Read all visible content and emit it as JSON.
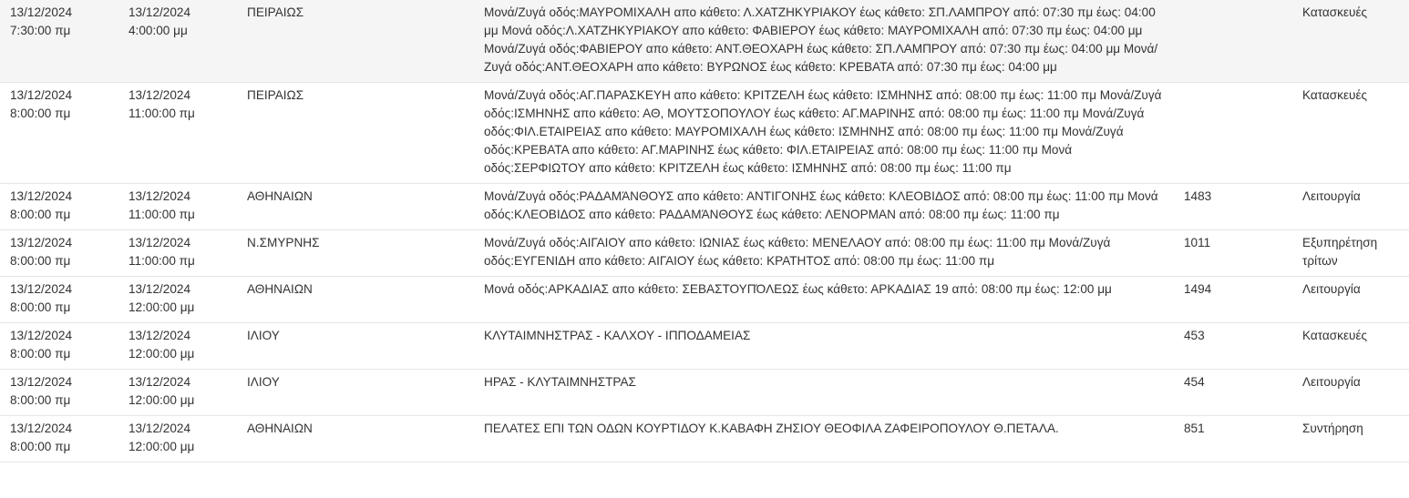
{
  "rows": [
    {
      "start_date": "13/12/2024",
      "start_time": "7:30:00 πμ",
      "end_date": "13/12/2024",
      "end_time": "4:00:00 μμ",
      "area": "ΠΕΙΡΑΙΩΣ",
      "description": "Μονά/Ζυγά οδός:ΜΑΥΡΟΜΙΧΑΛΗ απο κάθετο: Λ.ΧΑΤΖΗΚΥΡΙΑΚΟΥ έως κάθετο: ΣΠ.ΛΑΜΠΡΟΥ από: 07:30 πμ έως: 04:00 μμ Μονά οδός:Λ.ΧΑΤΖΗΚΥΡΙΑΚΟΥ απο κάθετο: ΦΑΒΙΕΡΟΥ έως κάθετο: ΜΑΥΡΟΜΙΧΑΛΗ από: 07:30 πμ έως: 04:00 μμ Μονά/Ζυγά οδός:ΦΑΒΙΕΡΟΥ απο κάθετο: ΑΝΤ.ΘΕΟΧΑΡΗ έως κάθετο: ΣΠ.ΛΑΜΠΡΟΥ από: 07:30 πμ έως: 04:00 μμ Μονά/Ζυγά οδός:ΑΝΤ.ΘΕΟΧΑΡΗ απο κάθετο: ΒΥΡΩΝΟΣ έως κάθετο: ΚΡΕΒΑΤΑ από: 07:30 πμ έως: 04:00 μμ",
      "number": "",
      "reason": "Κατασκευές"
    },
    {
      "start_date": "13/12/2024",
      "start_time": "8:00:00 πμ",
      "end_date": "13/12/2024",
      "end_time": "11:00:00 πμ",
      "area": "ΠΕΙΡΑΙΩΣ",
      "description": "Μονά/Ζυγά οδός:ΑΓ.ΠΑΡΑΣΚΕΥΗ απο κάθετο: ΚΡΙΤΖΕΛΗ έως κάθετο: ΙΣΜΗΝΗΣ από: 08:00 πμ έως: 11:00 πμ Μονά/Ζυγά οδός:ΙΣΜΗΝΗΣ απο κάθετο: ΑΘ, ΜΟΥΤΣΟΠΟΥΛΟΥ έως κάθετο: ΑΓ.ΜΑΡΙΝΗΣ από: 08:00 πμ έως: 11:00 πμ Μονά/Ζυγά οδός:ΦΙΛ.ΕΤΑΙΡΕΙΑΣ απο κάθετο: ΜΑΥΡΟΜΙΧΑΛΗ έως κάθετο: ΙΣΜΗΝΗΣ από: 08:00 πμ έως: 11:00 πμ Μονά/Ζυγά οδός:ΚΡΕΒΑΤΑ απο κάθετο: ΑΓ.ΜΑΡΙΝΗΣ έως κάθετο: ΦΙΛ.ΕΤΑΙΡΕΙΑΣ από: 08:00 πμ έως: 11:00 πμ Μονά οδός:ΣΕΡΦΙΩΤΟΥ απο κάθετο: ΚΡΙΤΖΕΛΗ έως κάθετο: ΙΣΜΗΝΗΣ από: 08:00 πμ έως: 11:00 πμ",
      "number": "",
      "reason": "Κατασκευές"
    },
    {
      "start_date": "13/12/2024",
      "start_time": "8:00:00 πμ",
      "end_date": "13/12/2024",
      "end_time": "11:00:00 πμ",
      "area": "ΑΘΗΝΑΙΩΝ",
      "description": "Μονά/Ζυγά οδός:ΡΑΔΑΜΆΝΘΟΥΣ απο κάθετο: ΑΝΤΙΓΟΝΗΣ έως κάθετο: ΚΛΕΟΒΙΔΟΣ από: 08:00 πμ έως: 11:00 πμ Μονά οδός:ΚΛΕΟΒΙΔΟΣ απο κάθετο: ΡΑΔΑΜΆΝΘΟΥΣ έως κάθετο: ΛΕΝΟΡΜΑΝ από: 08:00 πμ έως: 11:00 πμ",
      "number": "1483",
      "reason": "Λειτουργία"
    },
    {
      "start_date": "13/12/2024",
      "start_time": "8:00:00 πμ",
      "end_date": "13/12/2024",
      "end_time": "11:00:00 πμ",
      "area": "Ν.ΣΜΥΡΝΗΣ",
      "description": "Μονά/Ζυγά οδός:ΑΙΓΑΙΟΥ απο κάθετο: ΙΩΝΙΑΣ έως κάθετο: ΜΕΝΕΛΑΟΥ από: 08:00 πμ έως: 11:00 πμ Μονά/Ζυγά οδός:ΕΥΓΕΝΙΔΗ απο κάθετο: ΑΙΓΑΙΟΥ έως κάθετο: ΚΡΑΤΗΤΟΣ από: 08:00 πμ έως: 11:00 πμ",
      "number": "1011",
      "reason": "Εξυπηρέτηση τρίτων"
    },
    {
      "start_date": "13/12/2024",
      "start_time": "8:00:00 πμ",
      "end_date": "13/12/2024",
      "end_time": "12:00:00 μμ",
      "area": "ΑΘΗΝΑΙΩΝ",
      "description": "Μονά οδός:ΑΡΚΑΔΙΑΣ απο κάθετο: ΣΕΒΑΣΤΟΥΠΌΛΕΩΣ έως κάθετο: ΑΡΚΑΔΙΑΣ 19 από: 08:00 πμ έως: 12:00 μμ",
      "number": "1494",
      "reason": "Λειτουργία"
    },
    {
      "start_date": "13/12/2024",
      "start_time": "8:00:00 πμ",
      "end_date": "13/12/2024",
      "end_time": "12:00:00 μμ",
      "area": "ΙΛΙΟΥ",
      "description": "ΚΛΥΤΑΙΜΝΗΣΤΡΑΣ - ΚΑΛΧΟΥ - ΙΠΠΟΔΑΜΕΙΑΣ",
      "number": "453",
      "reason": "Κατασκευές"
    },
    {
      "start_date": "13/12/2024",
      "start_time": "8:00:00 πμ",
      "end_date": "13/12/2024",
      "end_time": "12:00:00 μμ",
      "area": "ΙΛΙΟΥ",
      "description": "ΗΡΑΣ - ΚΛΥΤΑΙΜΝΗΣΤΡΑΣ",
      "number": "454",
      "reason": "Λειτουργία"
    },
    {
      "start_date": "13/12/2024",
      "start_time": "8:00:00 πμ",
      "end_date": "13/12/2024",
      "end_time": "12:00:00 μμ",
      "area": "ΑΘΗΝΑΙΩΝ",
      "description": "ΠΕΛΑΤΕΣ ΕΠΙ ΤΩΝ ΟΔΩΝ ΚΟΥΡΤΙΔΟΥ Κ.ΚΑΒΑΦΗ ΖΗΣΙΟΥ ΘΕΟΦΙΛΑ ΖΑΦΕΙΡΟΠΟΥΛΟΥ Θ.ΠΕΤΑΛΑ.",
      "number": "851",
      "reason": "Συντήρηση"
    }
  ]
}
